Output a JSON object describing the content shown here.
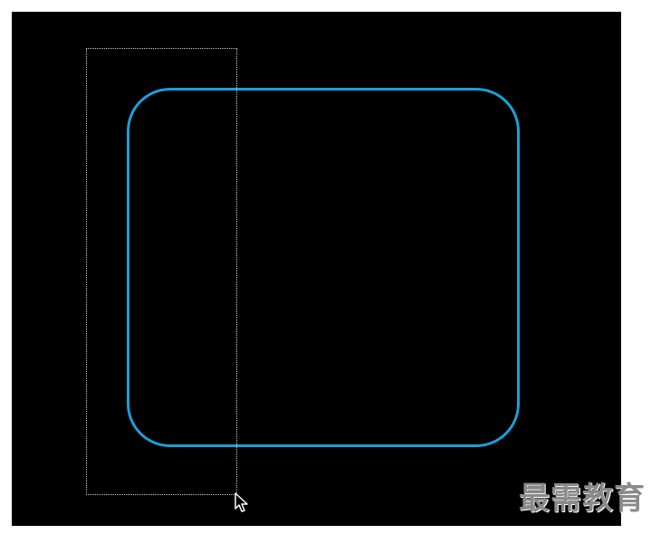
{
  "canvas": {
    "background": "#000000",
    "shape": {
      "kind": "rounded-rectangle",
      "stroke_color": "#1aa0d8"
    },
    "selection": {
      "kind": "marquee",
      "stroke_color": "#cfcfcf"
    },
    "cursor": {
      "icon": "arrow-pointer-icon"
    }
  },
  "watermark": {
    "text": "最需教育",
    "color": "#8a8a8a"
  }
}
